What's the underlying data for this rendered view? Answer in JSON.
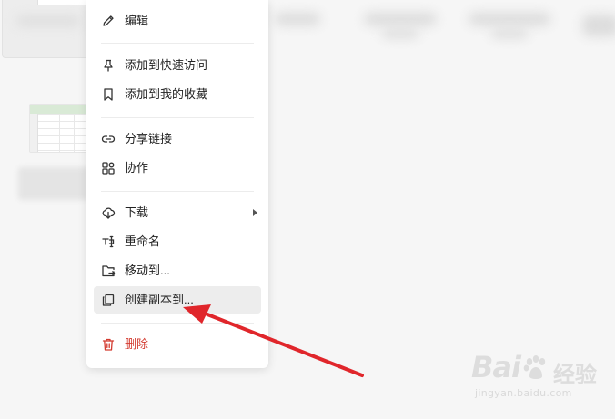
{
  "menu": {
    "items": [
      {
        "key": "edit",
        "icon": "pencil-icon",
        "label": "编辑"
      },
      {
        "key": "pin",
        "icon": "pin-icon",
        "label": "添加到快速访问"
      },
      {
        "key": "favorite",
        "icon": "bookmark-icon",
        "label": "添加到我的收藏"
      },
      {
        "key": "share",
        "icon": "link-icon",
        "label": "分享链接"
      },
      {
        "key": "collab",
        "icon": "collaborate-icon",
        "label": "协作"
      },
      {
        "key": "download",
        "icon": "cloud-download-icon",
        "label": "下载",
        "has_submenu": true
      },
      {
        "key": "rename",
        "icon": "rename-icon",
        "label": "重命名"
      },
      {
        "key": "move",
        "icon": "folder-move-icon",
        "label": "移动到..."
      },
      {
        "key": "copy",
        "icon": "copy-icon",
        "label": "创建副本到...",
        "highlighted": true
      },
      {
        "key": "delete",
        "icon": "trash-icon",
        "label": "删除",
        "danger": true
      }
    ]
  },
  "watermark": {
    "brand": "Bai",
    "brand_suffix": "经验",
    "url": "jingyan.baidu.com"
  },
  "colors": {
    "danger": "#d33a2f",
    "arrow": "#e0262b",
    "hover": "#ededed"
  }
}
